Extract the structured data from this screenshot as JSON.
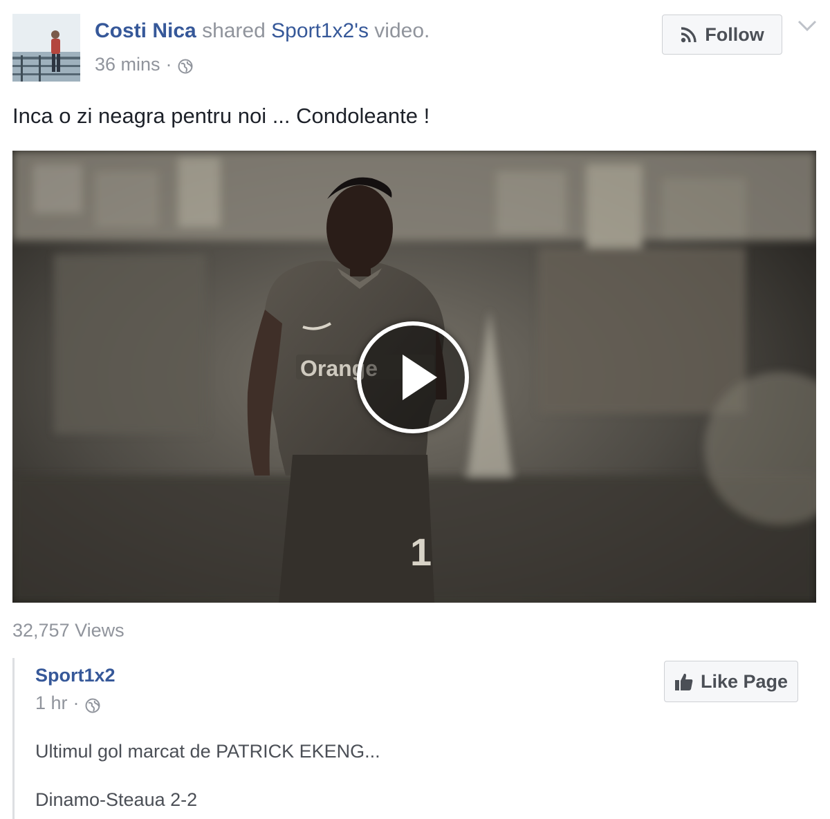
{
  "post": {
    "author": "Costi Nica",
    "shared_text": "shared",
    "shared_target": "Sport1x2's",
    "shared_suffix": "video.",
    "timestamp": "36 mins",
    "separator": "·",
    "follow_label": "Follow",
    "message": "Inca o zi neagra pentru noi ... Condoleante !",
    "views": "32,757 Views"
  },
  "video": {
    "jersey_text": "Orange",
    "jersey_number": "1"
  },
  "shared": {
    "page_name": "Sport1x2",
    "timestamp": "1 hr",
    "separator": "·",
    "like_page_label": "Like Page",
    "line_1": "Ultimul gol marcat de PATRICK EKENG...",
    "line_2": "Dinamo-Steaua 2-2"
  },
  "icons": {
    "follow": "rss-icon",
    "privacy": "globe-icon",
    "menu": "chevron-down-icon",
    "play": "play-icon",
    "like": "thumbs-up-icon"
  },
  "colors": {
    "link": "#365899",
    "muted": "#90949c",
    "text": "#1d2129",
    "button_bg": "#f6f7f9",
    "button_border": "#ced0d4"
  }
}
